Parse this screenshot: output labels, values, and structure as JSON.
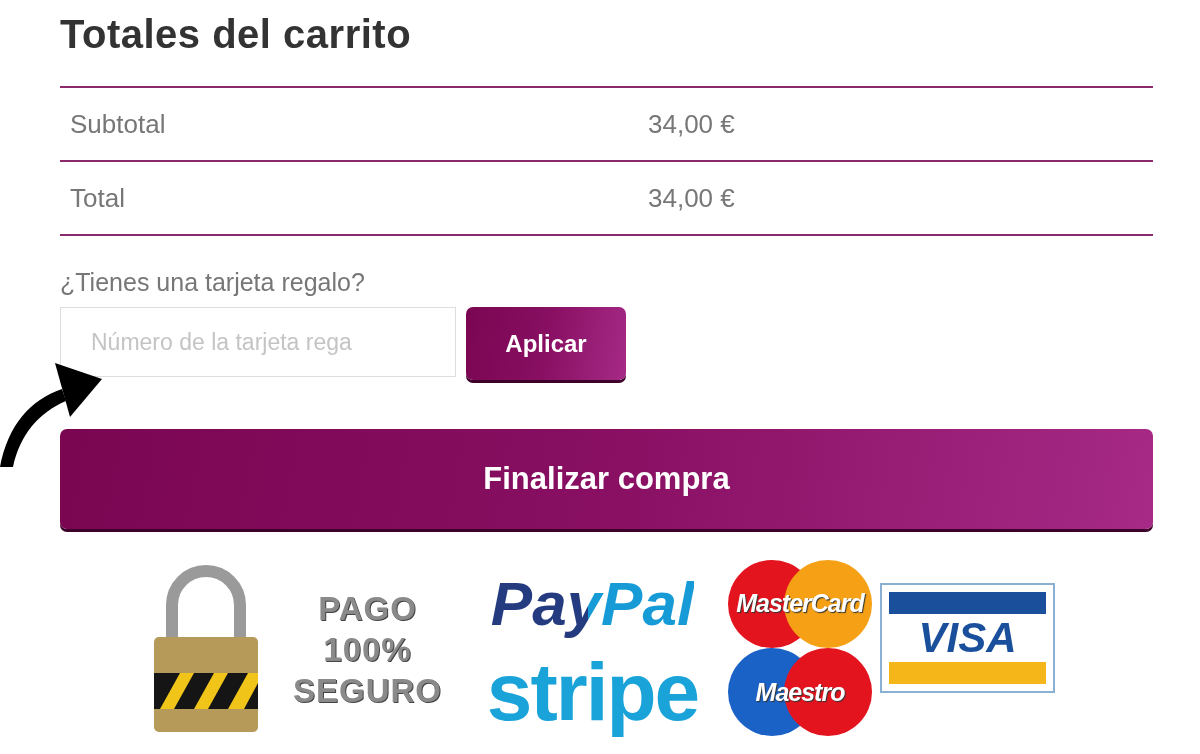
{
  "title": "Totales del carrito",
  "totals": [
    {
      "label": "Subtotal",
      "value": "34,00 €"
    },
    {
      "label": "Total",
      "value": "34,00 €"
    }
  ],
  "gift_card": {
    "label": "¿Tienes una tarjeta regalo?",
    "placeholder": "Número de la tarjeta rega",
    "button": "Aplicar"
  },
  "checkout_button": "Finalizar compra",
  "payment_badges": {
    "secure_text": [
      "PAGO",
      "100%",
      "SEGURO"
    ],
    "logos": [
      {
        "kind": "paypal",
        "text": "PayPal"
      },
      {
        "kind": "stripe",
        "text": "stripe"
      },
      {
        "kind": "mastercard",
        "text": "MasterCard"
      },
      {
        "kind": "maestro",
        "text": "Maestro"
      },
      {
        "kind": "visa",
        "text": "VISA"
      }
    ]
  }
}
